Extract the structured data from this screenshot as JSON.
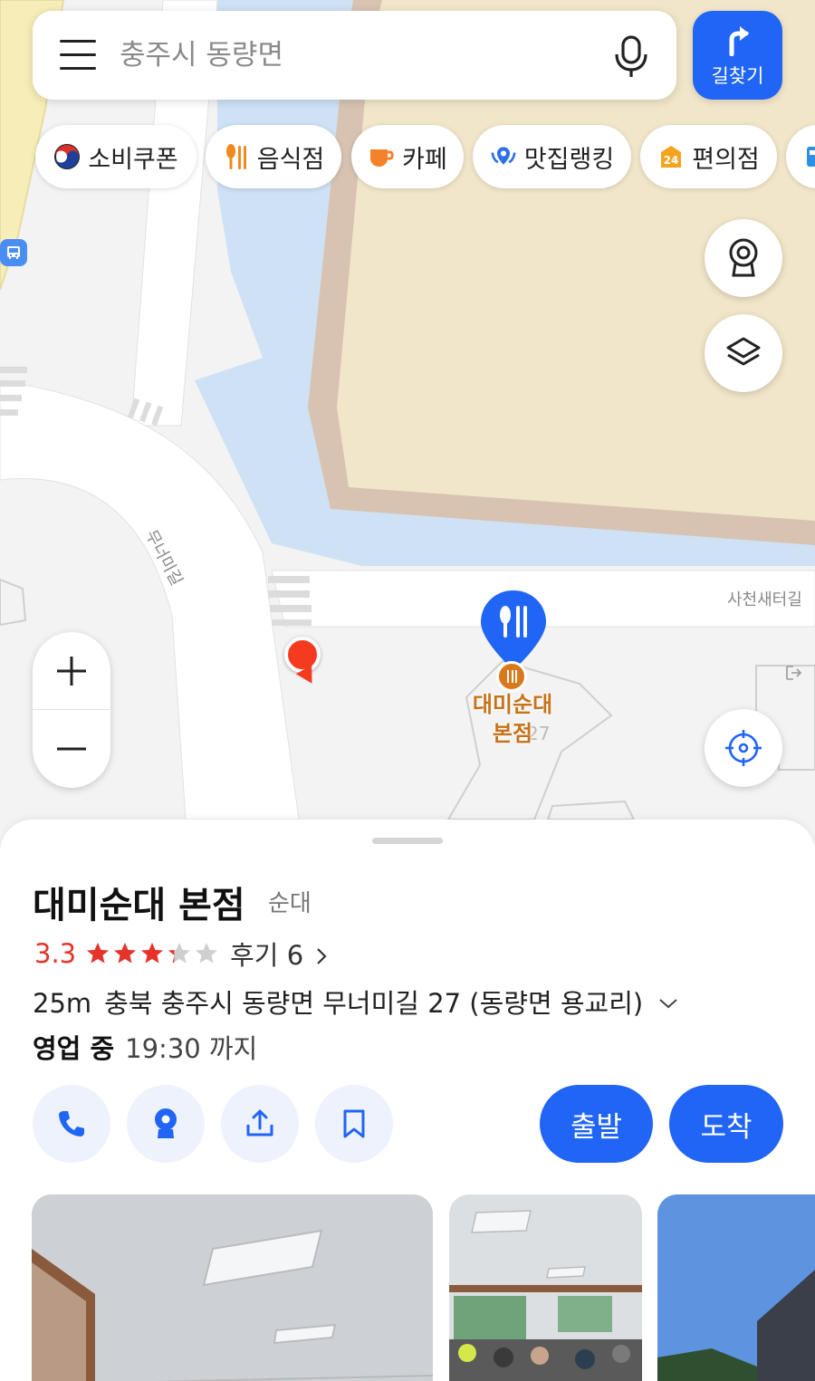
{
  "search": {
    "placeholder": "충주시 동량면",
    "value": ""
  },
  "route_button": {
    "label": "길찾기"
  },
  "chips": [
    {
      "label": "소비쿠폰",
      "icon": "korea-flag-icon"
    },
    {
      "label": "음식점",
      "icon": "restaurant-icon"
    },
    {
      "label": "카페",
      "icon": "cafe-cup-icon"
    },
    {
      "label": "맛집랭킹",
      "icon": "ranking-pin-icon"
    },
    {
      "label": "편의점",
      "icon": "convenience-24-icon"
    },
    {
      "label": "",
      "icon": "more-category-icon"
    }
  ],
  "convenience_badge": "24",
  "map": {
    "road_labels": {
      "vertical_road": "무너미길",
      "horizontal_road": "사천새터길"
    },
    "place_label": {
      "line1": "대미순대",
      "line2": "본점"
    },
    "house_number": "27",
    "colors": {
      "water": "#cfe1f5",
      "building": "#f1e6c9",
      "building_border": "#d8c3b2",
      "pin": "#2065f5",
      "place_dot": "#d9791c",
      "my_location": "#f43b1f"
    }
  },
  "place": {
    "name": "대미순대 본점",
    "category": "순대",
    "rating": "3.3",
    "rating_value": 3.3,
    "rating_max": 5,
    "review_label": "후기 6",
    "distance": "25m",
    "address": "충북 충주시 동량면 무너미길 27 (동량면 용교리)",
    "status": "영업 중",
    "hours": "19:30 까지"
  },
  "actions": {
    "depart_label": "출발",
    "arrive_label": "도착"
  },
  "accent_color": "#2065f5"
}
